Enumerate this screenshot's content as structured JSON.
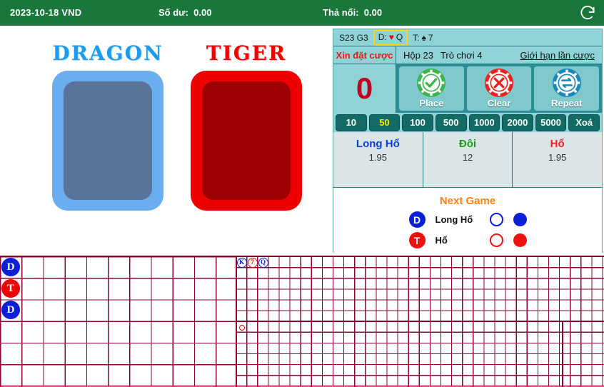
{
  "topbar": {
    "date_currency": "2023-10-18 VND",
    "balance_label": "Số dư:",
    "balance_value": "0.00",
    "float_label": "Thả nổi:",
    "float_value": "0.00",
    "refresh_icon": "refresh-icon"
  },
  "table": {
    "dragon_title": "DRAGON",
    "tiger_title": "TIGER",
    "dragon_card_face": "back",
    "tiger_card_face": "back"
  },
  "bet_panel": {
    "shoe_game": "S23 G3",
    "dragon_card_label": "D:",
    "dragon_card_suit": "♥",
    "dragon_card_rank": "Q",
    "tiger_card_label": "T:",
    "tiger_card_suit": "♠",
    "tiger_card_rank": "7",
    "status_text": "Xin đặt cược",
    "box_text": "Hộp 23",
    "game_text": "Trò chơi 4",
    "limit_link": "Giới hạn lần cược",
    "bet_amount": "0",
    "actions": [
      {
        "label": "Place",
        "icon": "chip-check-icon",
        "color": "#3cb44b"
      },
      {
        "label": "Clear",
        "icon": "chip-cross-icon",
        "color": "#ef2020"
      },
      {
        "label": "Repeat",
        "icon": "chip-repeat-icon",
        "color": "#1b88b8"
      }
    ],
    "chips": [
      {
        "label": "10",
        "selected": false
      },
      {
        "label": "50",
        "selected": true
      },
      {
        "label": "100",
        "selected": false
      },
      {
        "label": "500",
        "selected": false
      },
      {
        "label": "1000",
        "selected": false
      },
      {
        "label": "2000",
        "selected": false
      },
      {
        "label": "5000",
        "selected": false
      },
      {
        "label": "Xoá",
        "selected": false
      }
    ],
    "odds": [
      {
        "name": "Long Hổ",
        "value": "1.95",
        "color_class": "blue"
      },
      {
        "name": "Đôi",
        "value": "12",
        "color_class": "green"
      },
      {
        "name": "Hổ",
        "value": "1.95",
        "color_class": "red"
      }
    ]
  },
  "next_game": {
    "title": "Next Game",
    "rows": [
      {
        "badge": "D",
        "label": "Long Hổ",
        "ring_color": "blue",
        "dot_color": "blue"
      },
      {
        "badge": "T",
        "label": "Hổ",
        "ring_color": "red",
        "dot_color": "red"
      }
    ]
  },
  "roads": {
    "big_road": {
      "rows": 6,
      "cols": 11,
      "cell": 30,
      "marks": [
        {
          "col": 0,
          "row": 0,
          "text": "D",
          "type": "d"
        },
        {
          "col": 0,
          "row": 1,
          "text": "T",
          "type": "t"
        },
        {
          "col": 0,
          "row": 2,
          "text": "D",
          "type": "d"
        }
      ]
    },
    "small_road": {
      "cell": 15,
      "marks": [
        {
          "col": 0,
          "row": 0,
          "text": "K",
          "color": "blue"
        },
        {
          "col": 1,
          "row": 0,
          "text": "7",
          "color": "red"
        },
        {
          "col": 2,
          "row": 0,
          "text": "Q",
          "color": "blue"
        }
      ],
      "tiny_marks": [
        {
          "col": 0,
          "row": 6,
          "color": "red"
        }
      ]
    }
  },
  "colors": {
    "header_green": "#19773c",
    "panel_teal": "#8fd3d6",
    "odds_bg": "#dbe4e7",
    "grid_line": "#8c0035",
    "dragon_blue": "#0b1fd8",
    "tiger_red": "#ef0000",
    "accent_orange": "#ff7f0e",
    "chip_selected_yellow": "#ffe600"
  }
}
